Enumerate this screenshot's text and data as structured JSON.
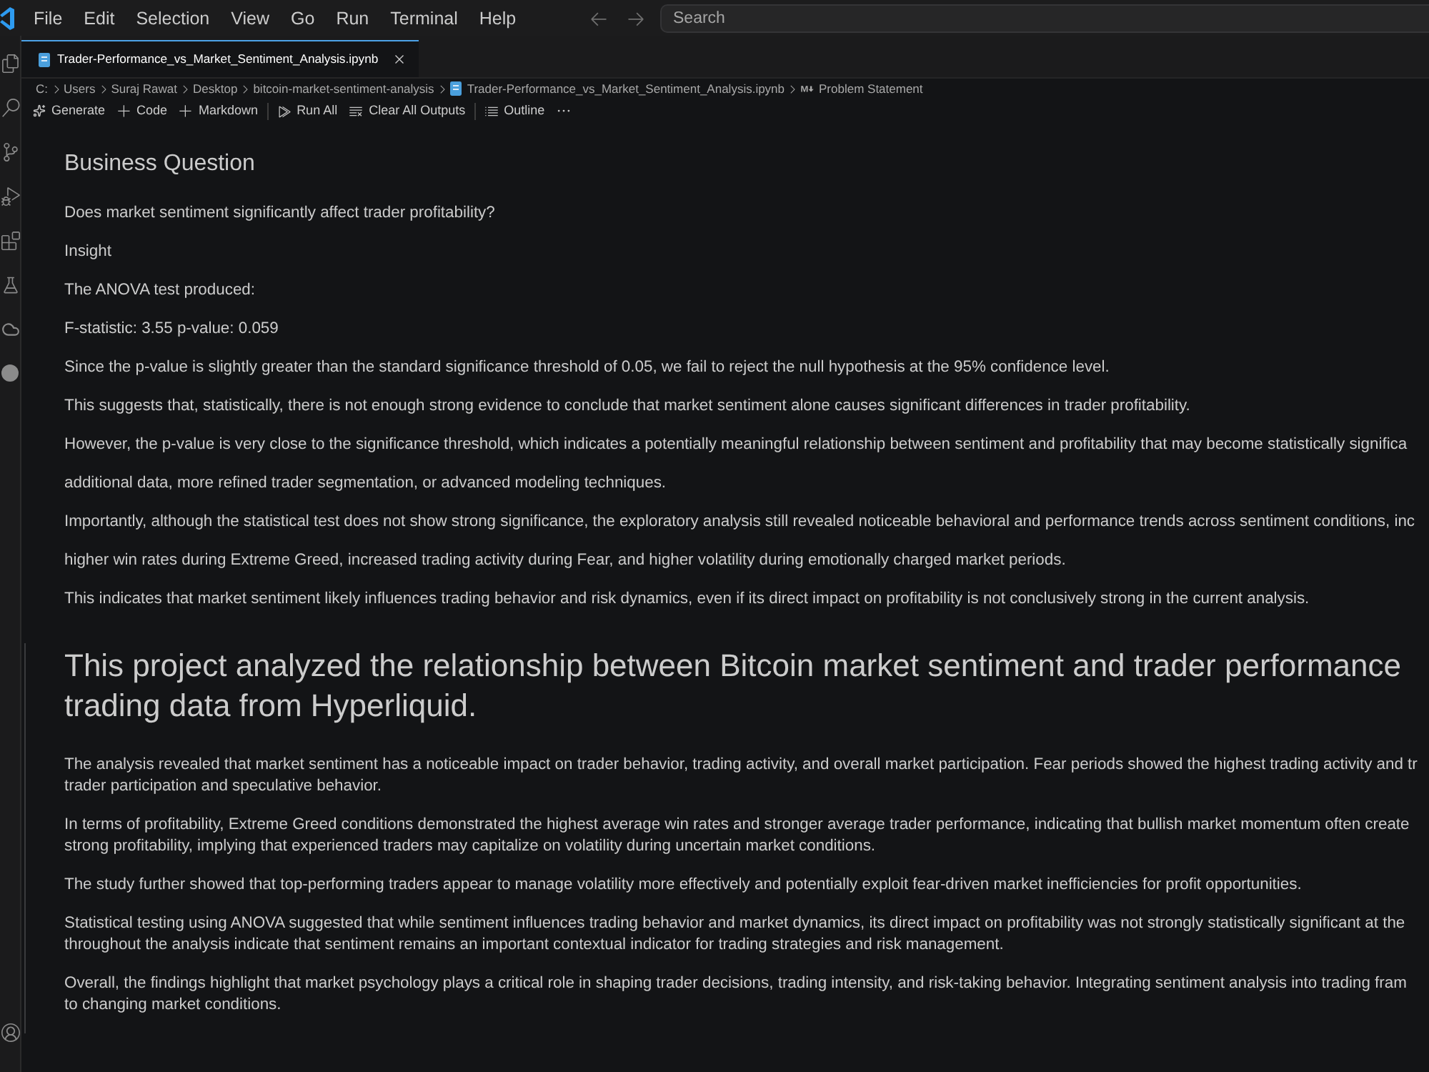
{
  "title_bar": {
    "menu": [
      "File",
      "Edit",
      "Selection",
      "View",
      "Go",
      "Run",
      "Terminal",
      "Help"
    ],
    "search": {
      "placeholder": "Search"
    }
  },
  "tabs": [
    {
      "label": "Trader-Performance_vs_Market_Sentiment_Analysis.ipynb",
      "selected": true
    }
  ],
  "breadcrumb": [
    {
      "kind": "folder",
      "label": "C:"
    },
    {
      "kind": "folder",
      "label": "Users"
    },
    {
      "kind": "folder",
      "label": "Suraj Rawat"
    },
    {
      "kind": "folder",
      "label": "Desktop"
    },
    {
      "kind": "folder",
      "label": "bitcoin-market-sentiment-analysis"
    },
    {
      "kind": "notebook",
      "label": "Trader-Performance_vs_Market_Sentiment_Analysis.ipynb"
    },
    {
      "kind": "markdown",
      "label": "Problem Statement"
    }
  ],
  "toolbar": [
    {
      "kind": "generate",
      "label": "Generate"
    },
    {
      "kind": "add",
      "label": "Code"
    },
    {
      "kind": "add",
      "label": "Markdown"
    },
    {
      "kind": "separator"
    },
    {
      "kind": "run",
      "label": "Run All"
    },
    {
      "kind": "clear",
      "label": "Clear All Outputs"
    },
    {
      "kind": "separator"
    },
    {
      "kind": "outline",
      "label": "Outline"
    },
    {
      "kind": "more"
    }
  ],
  "cells": [
    {
      "selected": false,
      "blocks": [
        {
          "kind": "h2",
          "lines": [
            "Business Question"
          ]
        },
        {
          "kind": "paragraph",
          "lines": [
            "Does market sentiment significantly affect trader profitability?"
          ]
        },
        {
          "kind": "paragraph",
          "lines": [
            "Insight"
          ]
        },
        {
          "kind": "paragraph",
          "lines": [
            "The ANOVA test produced:"
          ]
        },
        {
          "kind": "paragraph",
          "lines": [
            "F-statistic: 3.55 p-value: 0.059"
          ]
        },
        {
          "kind": "paragraph",
          "lines": [
            "Since the p-value is slightly greater than the standard significance threshold of 0.05, we fail to reject the null hypothesis at the 95% confidence level."
          ]
        },
        {
          "kind": "paragraph",
          "lines": [
            "This suggests that, statistically, there is not enough strong evidence to conclude that market sentiment alone causes significant differences in trader profitability."
          ]
        },
        {
          "kind": "paragraph",
          "lines": [
            "However, the p-value is very close to the significance threshold, which indicates a potentially meaningful relationship between sentiment and profitability that may become statistically significa"
          ]
        },
        {
          "kind": "paragraph",
          "lines": [
            "additional data, more refined trader segmentation, or advanced modeling techniques."
          ]
        },
        {
          "kind": "paragraph",
          "lines": [
            "Importantly, although the statistical test does not show strong significance, the exploratory analysis still revealed noticeable behavioral and performance trends across sentiment conditions, inc"
          ]
        },
        {
          "kind": "paragraph",
          "lines": [
            "higher win rates during Extreme Greed, increased trading activity during Fear, and higher volatility during emotionally charged market periods."
          ]
        },
        {
          "kind": "paragraph",
          "lines": [
            "This indicates that market sentiment likely influences trading behavior and risk dynamics, even if its direct impact on profitability is not conclusively strong in the current analysis."
          ]
        }
      ]
    },
    {
      "selected": true,
      "blocks": [
        {
          "kind": "h1",
          "lines": [
            "This project analyzed the relationship between Bitcoin market sentiment and trader performance",
            "trading data from Hyperliquid."
          ]
        },
        {
          "kind": "paragraph",
          "lines": [
            "The analysis revealed that market sentiment has a noticeable impact on trader behavior, trading activity, and overall market participation. Fear periods showed the highest trading activity and tr",
            "trader participation and speculative behavior."
          ]
        },
        {
          "kind": "paragraph",
          "lines": [
            "In terms of profitability, Extreme Greed conditions demonstrated the highest average win rates and stronger average trader performance, indicating that bullish market momentum often create",
            "strong profitability, implying that experienced traders may capitalize on volatility during uncertain market conditions."
          ]
        },
        {
          "kind": "paragraph",
          "lines": [
            "The study further showed that top-performing traders appear to manage volatility more effectively and potentially exploit fear-driven market inefficiencies for profit opportunities."
          ]
        },
        {
          "kind": "paragraph",
          "lines": [
            "Statistical testing using ANOVA suggested that while sentiment influences trading behavior and market dynamics, its direct impact on profitability was not strongly statistically significant at the",
            "throughout the analysis indicate that sentiment remains an important contextual indicator for trading strategies and risk management."
          ]
        },
        {
          "kind": "paragraph",
          "lines": [
            "Overall, the findings highlight that market psychology plays a critical role in shaping trader decisions, trading intensity, and risk-taking behavior. Integrating sentiment analysis into trading fram",
            "to changing market conditions."
          ]
        }
      ]
    }
  ]
}
